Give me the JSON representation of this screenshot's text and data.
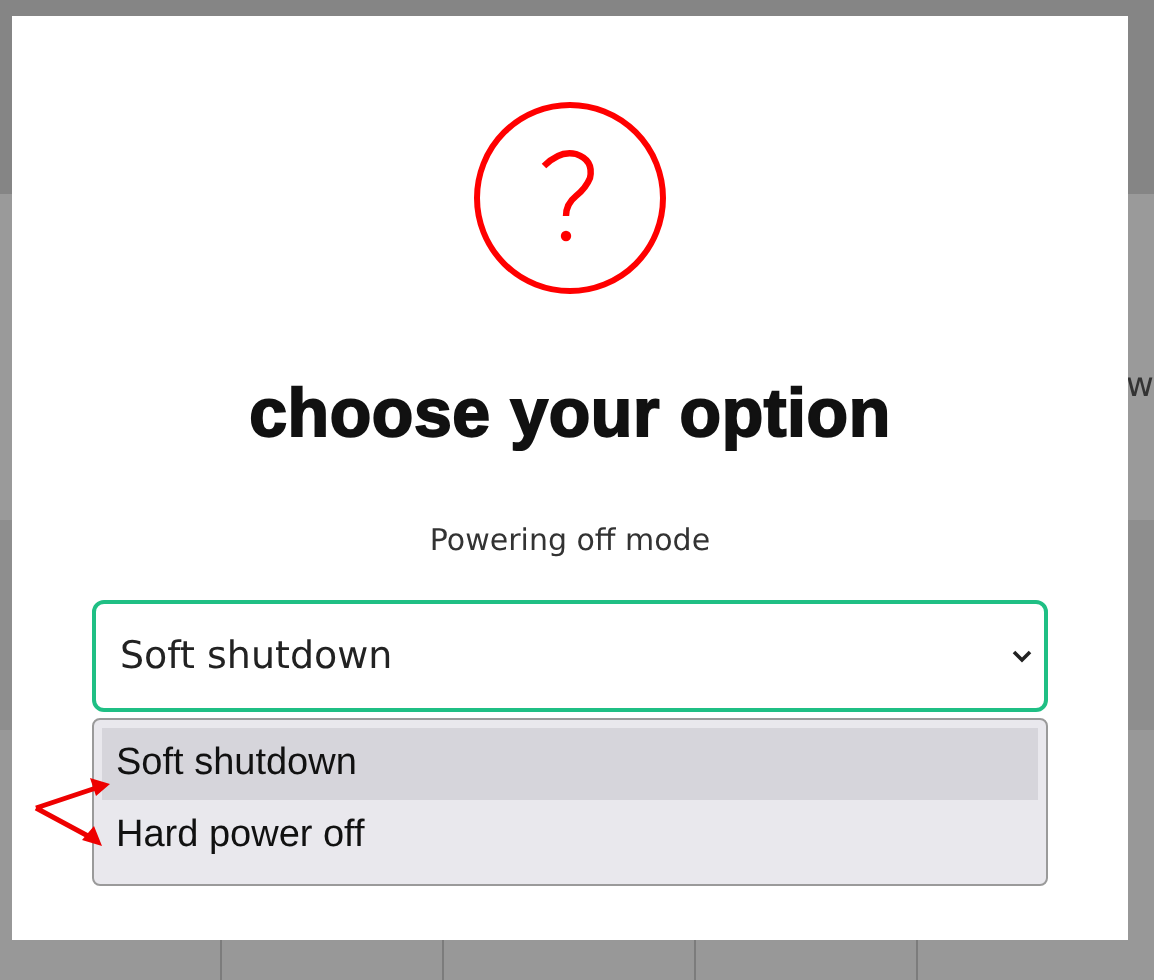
{
  "background": {
    "text": "w"
  },
  "dialog": {
    "title": "choose your option",
    "field_label": "Powering off mode",
    "select": {
      "value": "Soft shutdown",
      "options": [
        {
          "label": "Soft shutdown",
          "selected": true
        },
        {
          "label": "Hard power off",
          "selected": false
        }
      ]
    }
  }
}
